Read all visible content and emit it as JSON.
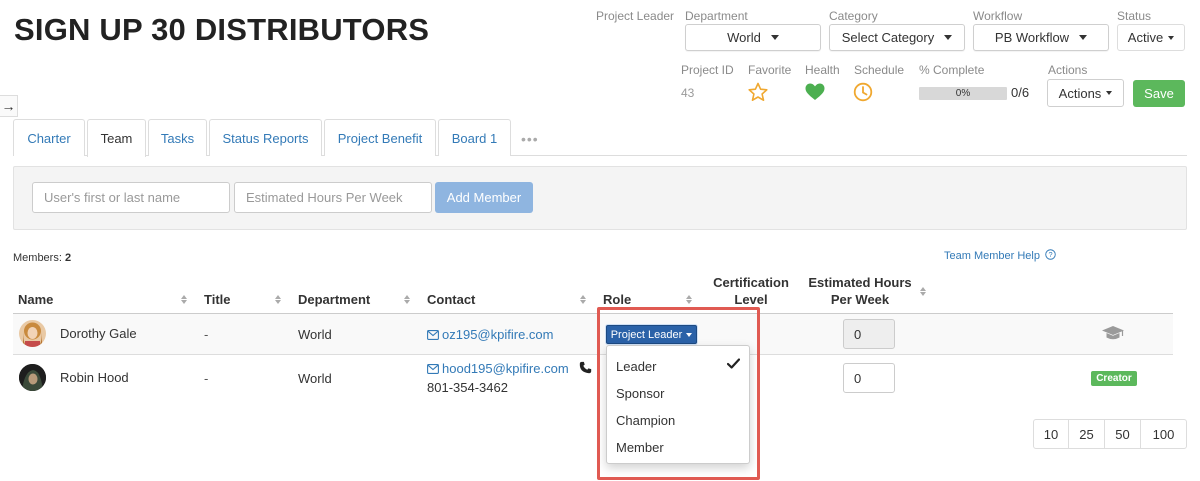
{
  "project": {
    "title": "SIGN UP 30 DISTRIBUTORS",
    "meta": {
      "project_leader_label": "Project Leader",
      "department_label": "Department",
      "department_value": "World",
      "category_label": "Category",
      "category_value": "Select Category",
      "workflow_label": "Workflow",
      "workflow_value": "PB Workflow",
      "status_label": "Status",
      "status_value": "Active",
      "project_id_label": "Project ID",
      "project_id_value": "43",
      "favorite_label": "Favorite",
      "health_label": "Health",
      "schedule_label": "Schedule",
      "percent_complete_label": "% Complete",
      "percent_value": "0%",
      "percent_fraction": 0,
      "task_count": "0/6",
      "actions_label": "Actions",
      "actions_button": "Actions",
      "save_button": "Save"
    }
  },
  "colors": {
    "accent_link": "#337ab7",
    "save_green": "#5cb85c",
    "health_green": "#4caf50",
    "favorite_star": "#f0a830",
    "schedule_clock": "#f0a830",
    "highlight_red": "#e05a52",
    "role_blue": "#2b62a8"
  },
  "tabs": [
    {
      "label": "Charter"
    },
    {
      "label": "Team"
    },
    {
      "label": "Tasks"
    },
    {
      "label": "Status Reports"
    },
    {
      "label": "Project Benefit"
    },
    {
      "label": "Board 1"
    }
  ],
  "tabs_more": "•••",
  "add_member": {
    "name_placeholder": "User's first or last name",
    "hours_placeholder": "Estimated Hours Per Week",
    "add_button": "Add Member"
  },
  "team": {
    "members_label": "Members:",
    "members_count": "2",
    "help_link": "Team Member Help",
    "columns": {
      "name": "Name",
      "title": "Title",
      "department": "Department",
      "contact": "Contact",
      "role": "Role",
      "certification_line1": "Certification",
      "certification_line2": "Level",
      "hours_line1": "Estimated Hours",
      "hours_line2": "Per Week"
    },
    "rows": [
      {
        "name": "Dorothy Gale",
        "title": "-",
        "department": "World",
        "email": "oz195@kpifire.com",
        "phone": "",
        "role": "Project Leader",
        "hours": "0",
        "icon": "graduation-cap-icon"
      },
      {
        "name": "Robin Hood",
        "title": "-",
        "department": "World",
        "email": "hood195@kpifire.com",
        "phone": "801-354-3462",
        "role": "",
        "hours": "0",
        "badge": "Creator"
      }
    ]
  },
  "role_menu": {
    "options": [
      "Leader",
      "Sponsor",
      "Champion",
      "Member"
    ],
    "selected": "Leader"
  },
  "pagination": {
    "sizes": [
      "10",
      "25",
      "50",
      "100"
    ]
  }
}
